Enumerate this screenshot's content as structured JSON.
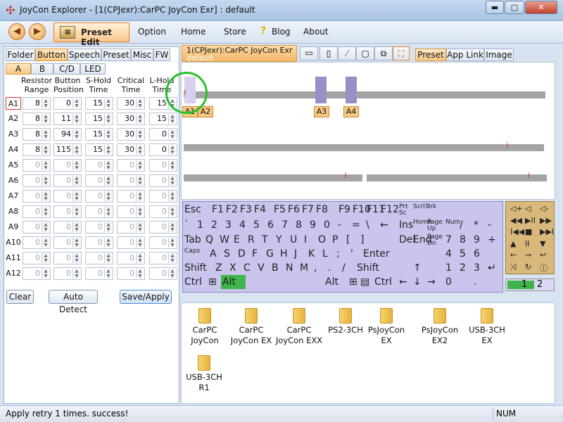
{
  "window": {
    "title": "JoyCon Explorer - [1(CPJexr):CarPC JoyCon Exr] : default",
    "minimize": "▬",
    "maximize": "□",
    "close": "✕"
  },
  "menu": {
    "back": "◀",
    "forward": "▶",
    "preset_edit": "Preset Edit",
    "option": "Option",
    "home": "Home",
    "store": "Store",
    "blog": "Blog",
    "about": "About",
    "blog_icon": "?"
  },
  "left_tabs": [
    "Folder",
    "Button",
    "Speech",
    "Preset",
    "Misc",
    "FW"
  ],
  "sub_tabs": [
    "A",
    "B",
    "C/D",
    "LED"
  ],
  "grid": {
    "headers": [
      "Resistor Range",
      "Button Position",
      "S-Hold Time",
      "Critical Time",
      "L-Hold Time"
    ],
    "rows": [
      {
        "label": "A1",
        "vals": [
          "8",
          "0",
          "15",
          "30",
          "15"
        ],
        "active": true
      },
      {
        "label": "A2",
        "vals": [
          "8",
          "11",
          "15",
          "30",
          "15"
        ],
        "active": true
      },
      {
        "label": "A3",
        "vals": [
          "8",
          "94",
          "15",
          "30",
          "0"
        ],
        "active": true
      },
      {
        "label": "A4",
        "vals": [
          "8",
          "115",
          "15",
          "30",
          "0"
        ],
        "active": true
      },
      {
        "label": "A5",
        "vals": [
          "0",
          "0",
          "0",
          "0",
          "0"
        ],
        "active": false
      },
      {
        "label": "A6",
        "vals": [
          "0",
          "0",
          "0",
          "0",
          "0"
        ],
        "active": false
      },
      {
        "label": "A7",
        "vals": [
          "0",
          "0",
          "0",
          "0",
          "0"
        ],
        "active": false
      },
      {
        "label": "A8",
        "vals": [
          "0",
          "0",
          "0",
          "0",
          "0"
        ],
        "active": false
      },
      {
        "label": "A9",
        "vals": [
          "0",
          "0",
          "0",
          "0",
          "0"
        ],
        "active": false
      },
      {
        "label": "A10",
        "vals": [
          "0",
          "0",
          "0",
          "0",
          "0"
        ],
        "active": false
      },
      {
        "label": "A11",
        "vals": [
          "0",
          "0",
          "0",
          "0",
          "0"
        ],
        "active": false
      },
      {
        "label": "A12",
        "vals": [
          "0",
          "0",
          "0",
          "0",
          "0"
        ],
        "active": false
      }
    ]
  },
  "left_buttons": {
    "clear": "Clear",
    "auto_detect": "Auto Detect",
    "save_apply": "Save/Apply"
  },
  "device_tab": {
    "name": "1(CPJexr):CarPC JoyCon Exr",
    "sub": "default"
  },
  "right_tabs": [
    "Preset",
    "App Link",
    "Image"
  ],
  "preview": {
    "keys": [
      "A1",
      "A2",
      "A3",
      "A4"
    ]
  },
  "keyboard": {
    "row0": [
      "Esc",
      "F1",
      "F2",
      "F3",
      "F4",
      "F5",
      "F6",
      "F7",
      "F8",
      "F9",
      "F10",
      "F11",
      "F12",
      "Prt Sc",
      "Scrl",
      "Brk"
    ],
    "row1": [
      "`",
      "1",
      "2",
      "3",
      "4",
      "5",
      "6",
      "7",
      "8",
      "9",
      "0",
      "-",
      "=",
      "\\",
      "←",
      "Ins",
      "Home",
      "Page Up",
      "Num",
      "/",
      "*",
      "-"
    ],
    "row2": [
      "Tab",
      "Q",
      "W",
      "E",
      "R",
      "T",
      "Y",
      "U",
      "I",
      "O",
      "P",
      "[",
      "]",
      "Del",
      "End",
      "Page Dn",
      "7",
      "8",
      "9",
      "+"
    ],
    "row3": [
      "Caps",
      "A",
      "S",
      "D",
      "F",
      "G",
      "H",
      "J",
      "K",
      "L",
      ";",
      "'",
      "Enter",
      "4",
      "5",
      "6"
    ],
    "row4": [
      "Shift",
      "Z",
      "X",
      "C",
      "V",
      "B",
      "N",
      "M",
      ",",
      ".",
      "/",
      "Shift",
      "↑",
      "1",
      "2",
      "3",
      "↵"
    ],
    "row5": [
      "Ctrl",
      "⊞",
      "Alt",
      "Alt",
      "⊞",
      "▤",
      "Ctrl",
      "←",
      "↓",
      "→",
      "0",
      "."
    ]
  },
  "nav_panel": [
    "◁+",
    "◁",
    "◁-",
    "◀◀",
    "▶II",
    "▶▶",
    "I◀◀",
    "■",
    "▶▶I",
    "▲",
    "II",
    "▼",
    "←",
    "→",
    "↩",
    "⤨",
    "↻",
    "ⓘ"
  ],
  "switch": {
    "one": "1",
    "two": "2"
  },
  "folders": [
    "CarPC JoyCon",
    "CarPC JoyCon EX",
    "CarPC JoyCon EXX",
    "PS2-3CH",
    "PsJoyCon EX",
    "PsJoyCon EX2",
    "USB-3CH EX",
    "USB-3CH R1"
  ],
  "status": {
    "message": "Apply retry  1 times. success!",
    "num": "NUM"
  }
}
